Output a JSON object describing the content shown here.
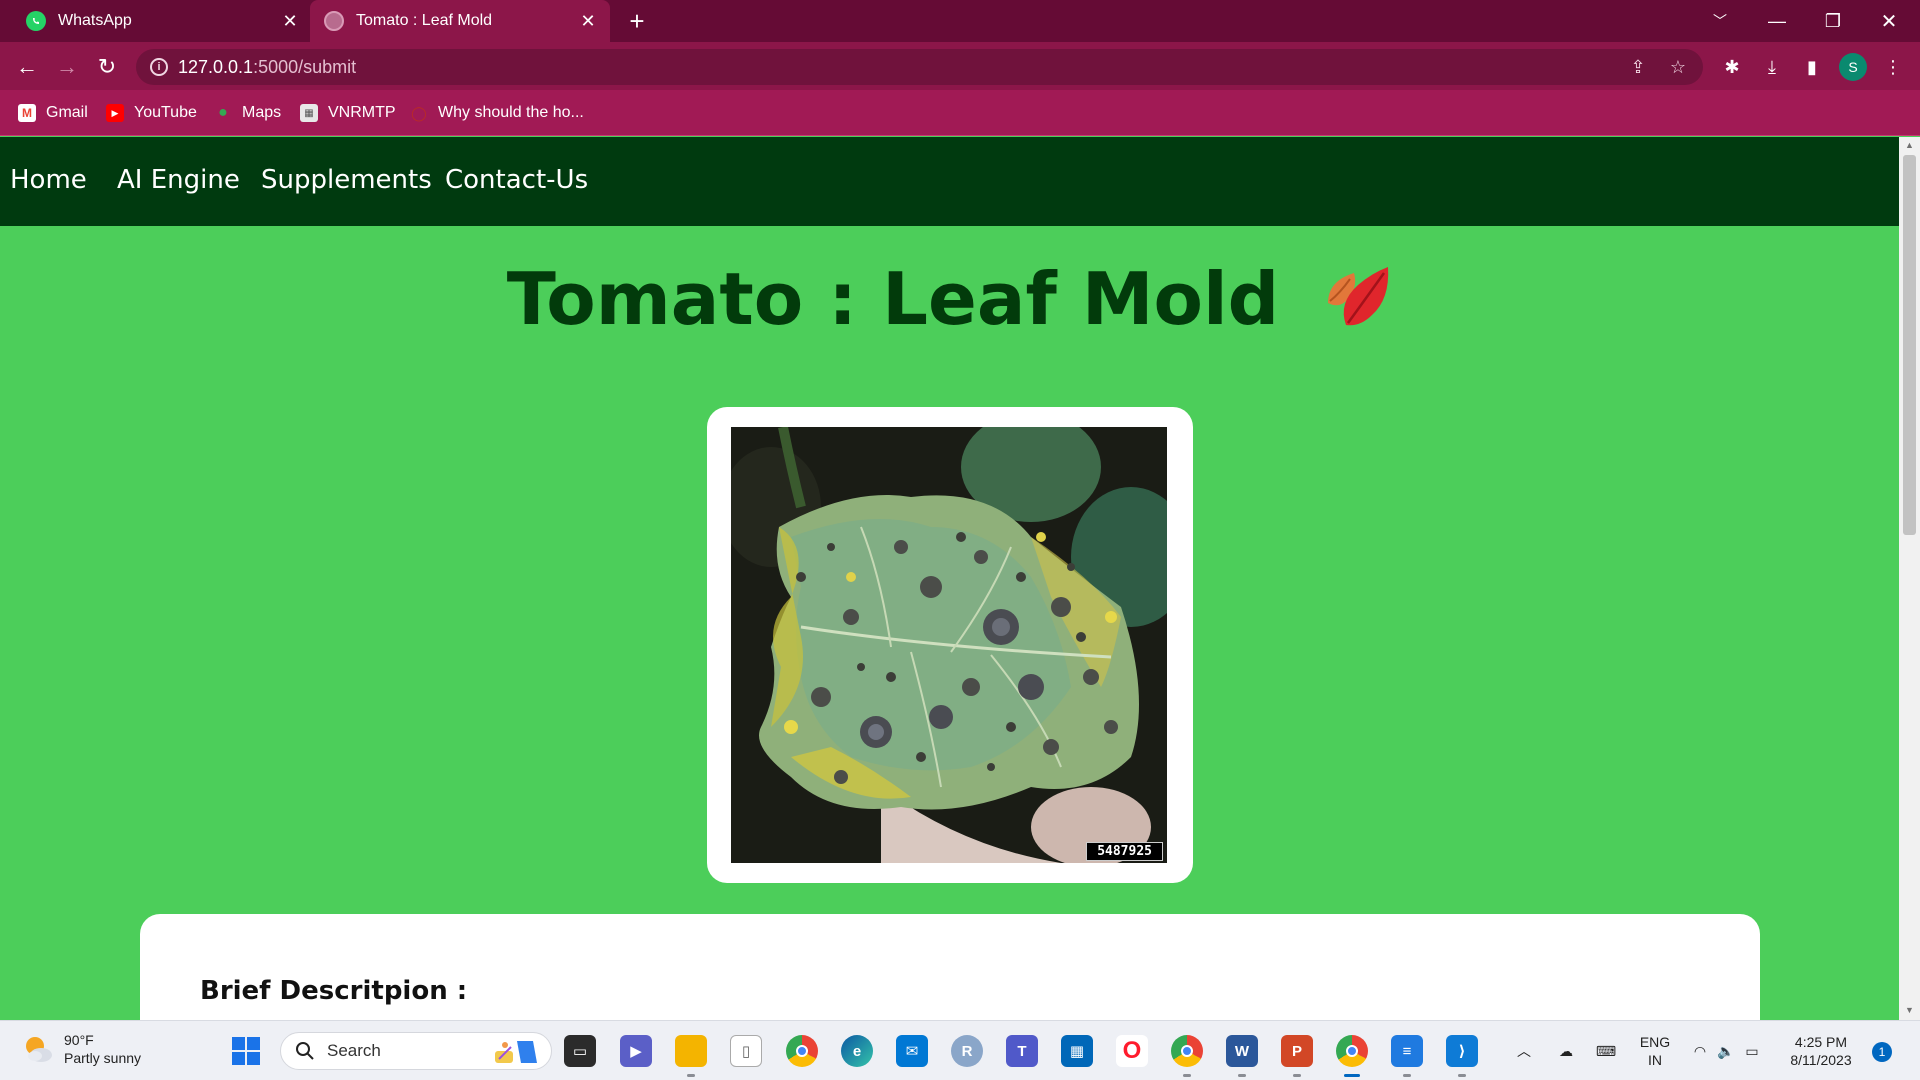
{
  "browser": {
    "tabs": [
      {
        "title": "WhatsApp",
        "favicon": "whatsapp-icon",
        "active": false
      },
      {
        "title": "Tomato : Leaf Mold",
        "favicon": "globe-icon",
        "active": true
      }
    ],
    "url_host": "127.0.0.1",
    "url_path": ":5000/submit",
    "bookmarks": [
      {
        "label": "Gmail",
        "icon": "gmail-icon"
      },
      {
        "label": "YouTube",
        "icon": "youtube-icon"
      },
      {
        "label": "Maps",
        "icon": "maps-icon"
      },
      {
        "label": "VNRMTP",
        "icon": "vnrmtp-icon"
      },
      {
        "label": "Why should the ho...",
        "icon": "quora-icon"
      }
    ],
    "profile_initial": "S",
    "colors": {
      "tabbar": "#650b35",
      "toolbar": "#8c1649",
      "bookmarks_bar": "#a11a55"
    }
  },
  "site": {
    "nav": [
      "Home",
      "AI Engine",
      "Supplements",
      "Contact-Us"
    ],
    "heading": "Tomato : Leaf Mold",
    "heading_emoji": "fallen-leaf-icon",
    "image_label": "5487925",
    "description_title": "Brief Descritpion :",
    "colors": {
      "background": "#4cce5a",
      "navbar": "#003a0f",
      "heading": "#023b0b"
    }
  },
  "taskbar": {
    "weather_temp": "90°F",
    "weather_desc": "Partly sunny",
    "search_placeholder": "Search",
    "lang_top": "ENG",
    "lang_bottom": "IN",
    "time": "4:25 PM",
    "date": "8/11/2023",
    "notification_count": "1",
    "pinned": [
      "task-view-icon",
      "teams-meet-icon",
      "file-explorer-icon",
      "notepad-file-icon",
      "chrome-icon",
      "edge-icon",
      "mail-icon",
      "r-icon",
      "teams-icon",
      "store-icon",
      "opera-icon",
      "chrome-profile-j-icon",
      "word-icon",
      "powerpoint-icon",
      "chrome-profile-s-icon",
      "notepad-icon",
      "vscode-icon"
    ]
  }
}
